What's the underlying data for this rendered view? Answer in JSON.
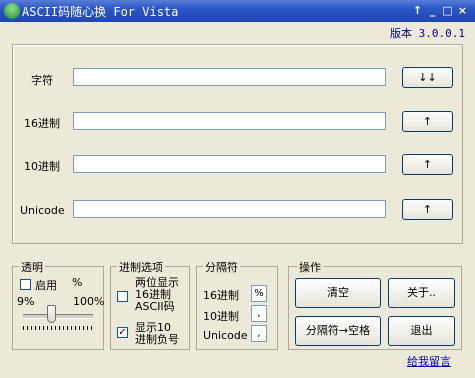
{
  "window": {
    "title": "ASCII码随心换 For Vista",
    "controls": [
      "↑",
      "_",
      "□",
      "×"
    ]
  },
  "version": "版本 3.0.0.1",
  "rows": [
    {
      "label": "字符",
      "value": "",
      "button": "↓↓"
    },
    {
      "label": "16进制",
      "value": "",
      "button": "↑"
    },
    {
      "label": "10进制",
      "value": "",
      "button": "↑"
    },
    {
      "label": "Unicode",
      "value": "",
      "button": "↑"
    }
  ],
  "transparency": {
    "legend": "透明",
    "enable_label": "启用",
    "enabled": false,
    "percent_sign": "%",
    "min_label": "9%",
    "max_label": "100%",
    "level": 0.4
  },
  "options": {
    "legend": "进制选项",
    "show_two_digit_label": "两位显示16进制ASCII码",
    "show_two_digit_lines": [
      "两位显示",
      "16进制",
      "ASCII码"
    ],
    "show_two_digit_checked": false,
    "show_negative_label": "显示10进制负号",
    "show_negative_lines": [
      "显示10",
      "进制负号"
    ],
    "show_negative_checked": true
  },
  "separator": {
    "legend": "分隔符",
    "items": [
      {
        "label": "16进制",
        "value": "%"
      },
      {
        "label": "10进制",
        "value": ","
      },
      {
        "label": "Unicode",
        "value": ","
      }
    ]
  },
  "operations": {
    "legend": "操作",
    "clear": "清空",
    "about": "关于..",
    "sep_to_space": "分隔符→空格",
    "exit": "退出"
  },
  "feedback_link": "给我留言"
}
